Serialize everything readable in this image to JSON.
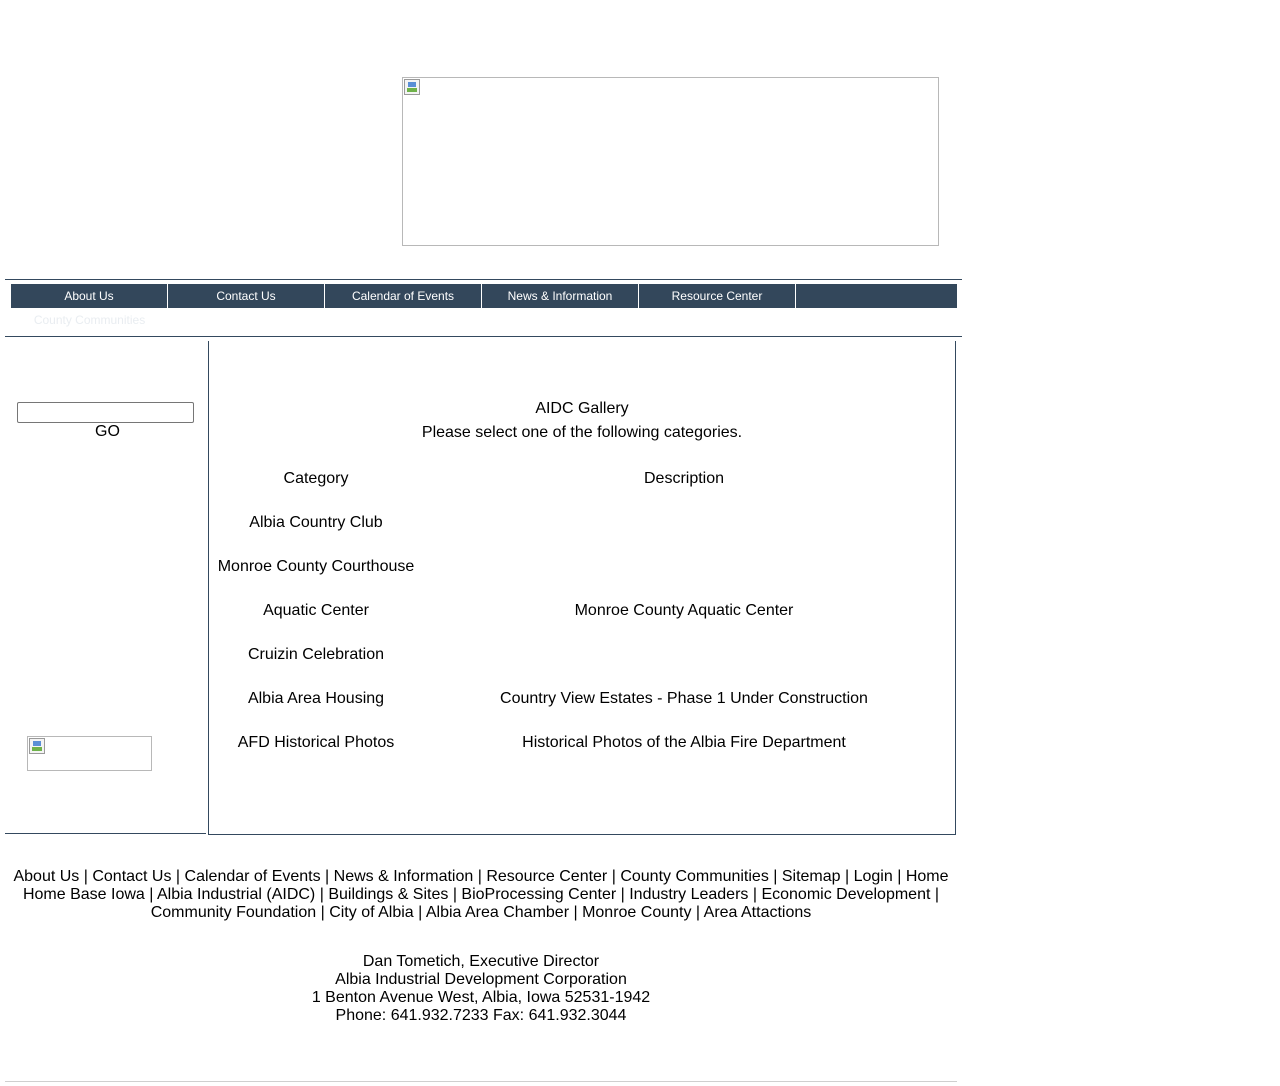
{
  "nav": {
    "items": [
      "About Us",
      "Contact Us",
      "Calendar of Events",
      "News & Information",
      "Resource Center",
      "County Communities"
    ]
  },
  "sidebar": {
    "search_value": "",
    "go_label": "GO"
  },
  "gallery": {
    "title": "AIDC Gallery",
    "subtitle": "Please select one of the following categories.",
    "col_category": "Category",
    "col_description": "Description",
    "rows": [
      {
        "category": "Albia Country Club",
        "description": ""
      },
      {
        "category": "Monroe County Courthouse",
        "description": ""
      },
      {
        "category": "Aquatic Center",
        "description": "Monroe County Aquatic Center"
      },
      {
        "category": "Cruizin Celebration",
        "description": ""
      },
      {
        "category": "Albia Area Housing",
        "description": "Country View Estates - Phase 1 Under Construction"
      },
      {
        "category": "AFD Historical Photos",
        "description": "Historical Photos of the Albia Fire Department"
      }
    ]
  },
  "footer": {
    "line1": [
      "About Us",
      "Contact Us",
      "Calendar of Events",
      "News & Information",
      "Resource Center",
      "County Communities",
      "Sitemap",
      "Login",
      "Home"
    ],
    "line2": [
      "Home Base Iowa",
      "Albia Industrial (AIDC)",
      "Buildings & Sites",
      "BioProcessing Center",
      "Industry Leaders",
      "Economic Development"
    ],
    "line3": [
      "Community Foundation",
      "City of Albia",
      "Albia Area Chamber",
      "Monroe County",
      "Area Attactions"
    ],
    "separator": " | "
  },
  "contact": {
    "name": "Dan Tometich, Executive Director",
    "org": "Albia Industrial Development Corporation",
    "address": "1 Benton Avenue West, Albia, Iowa 52531-1942",
    "phone": "Phone: 641.932.7233 Fax: 641.932.3044"
  },
  "colors": {
    "nav_bg": "#33475b",
    "rule": "#34495e"
  }
}
